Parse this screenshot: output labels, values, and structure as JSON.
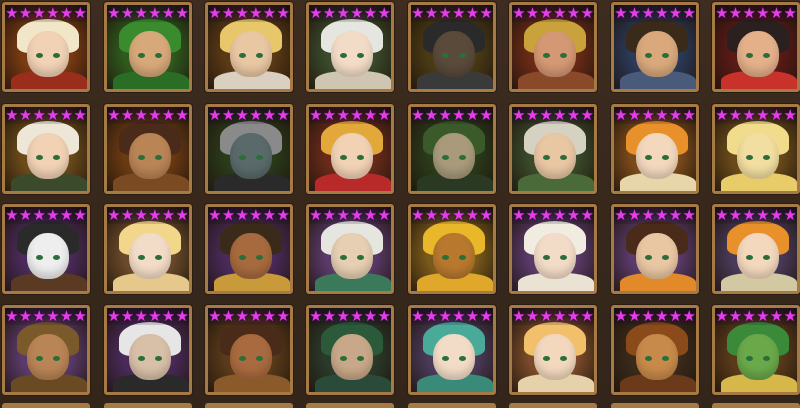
{
  "screen": "monster-collection-grid",
  "star_rating": 6,
  "colors": {
    "background": "#3a2a1d",
    "frame": "#a57a45",
    "star": "#e23fe6"
  },
  "monsters": [
    [
      {
        "name": "fire-elf-girl",
        "bg": "#7a3a12",
        "hair": "#f2e6c8",
        "body": "#9a2d1c",
        "face": "#f1d2b5"
      },
      {
        "name": "wind-ranger",
        "bg": "#2f5a1e",
        "hair": "#3a8a2e",
        "body": "#2a6d24",
        "face": "#d7a879"
      },
      {
        "name": "blonde-warrior",
        "bg": "#5a3a15",
        "hair": "#e8c66a",
        "body": "#d9d0c2",
        "face": "#e9c7a3"
      },
      {
        "name": "silver-haired-girl",
        "bg": "#3a4a2a",
        "hair": "#e6e6e0",
        "body": "#cfc6b2",
        "face": "#f3dcc7"
      },
      {
        "name": "dark-knight",
        "bg": "#4a3a14",
        "hair": "#2a2a2a",
        "body": "#3a3a3a",
        "face": "#5a4a3a"
      },
      {
        "name": "brawler",
        "bg": "#6a2a16",
        "hair": "#c9a23b",
        "body": "#8a4a2a",
        "face": "#d49874"
      },
      {
        "name": "blue-bandit",
        "bg": "#2a3a5a",
        "hair": "#3a2a1a",
        "body": "#4a5a7a",
        "face": "#d9a97c"
      },
      {
        "name": "red-headband-fighter",
        "bg": "#5a1a16",
        "hair": "#2a2020",
        "body": "#c8322a",
        "face": "#e3b08a"
      }
    ],
    [
      {
        "name": "white-haired-elf",
        "bg": "#6a4a1a",
        "hair": "#eee6d6",
        "body": "#3a4a2a",
        "face": "#f1d2b5"
      },
      {
        "name": "tan-shaman",
        "bg": "#6a3a12",
        "hair": "#4a2a18",
        "body": "#7a4a22",
        "face": "#b98456"
      },
      {
        "name": "dark-assassin",
        "bg": "#2a3a1a",
        "hair": "#8a8a8a",
        "body": "#2a2a2a",
        "face": "#5a6a6a"
      },
      {
        "name": "blonde-mage",
        "bg": "#6a2a1a",
        "hair": "#e2a83a",
        "body": "#b82a2a",
        "face": "#f1d2b5"
      },
      {
        "name": "green-hooded",
        "bg": "#2a3a1a",
        "hair": "#3a5a2a",
        "body": "#2a3a22",
        "face": "#a89a7a"
      },
      {
        "name": "forest-guardian",
        "bg": "#3a4a2a",
        "hair": "#d6d2c2",
        "body": "#4a6a3a",
        "face": "#e9c7a3"
      },
      {
        "name": "orange-fairy",
        "bg": "#7a4a1a",
        "hair": "#e8902a",
        "body": "#e6d6aa",
        "face": "#f3d8bd"
      },
      {
        "name": "golden-horse",
        "bg": "#6a4a1a",
        "hair": "#f0dc8a",
        "body": "#e8cc6a",
        "face": "#f2dea0"
      }
    ],
    [
      {
        "name": "panda-warrior",
        "bg": "#4a2a5a",
        "hair": "#2a2a2a",
        "body": "#5a3a22",
        "face": "#eeeeee"
      },
      {
        "name": "golden-elf",
        "bg": "#6a4a2a",
        "hair": "#f2d68a",
        "body": "#e6c88a",
        "face": "#f3dcc7"
      },
      {
        "name": "egyptian-priestess",
        "bg": "#4a2a5a",
        "hair": "#3a2a1a",
        "body": "#c89a3a",
        "face": "#a66a3e"
      },
      {
        "name": "jade-elder",
        "bg": "#5a3a6a",
        "hair": "#e6e6e0",
        "body": "#3a7a5a",
        "face": "#e6cfb2"
      },
      {
        "name": "sun-goddess",
        "bg": "#7a5a1a",
        "hair": "#e8b82a",
        "body": "#e0a82a",
        "face": "#b8782e"
      },
      {
        "name": "white-angel",
        "bg": "#5a3a6a",
        "hair": "#f0ece0",
        "body": "#eae2d2",
        "face": "#f3dcc7"
      },
      {
        "name": "monk-boy",
        "bg": "#5a3a6a",
        "hair": "#4a2a18",
        "body": "#e28a2a",
        "face": "#e9c7a3"
      },
      {
        "name": "orange-sprite",
        "bg": "#4a3a5a",
        "hair": "#e8902a",
        "body": "#d2c8a2",
        "face": "#f3d8bd"
      }
    ],
    [
      {
        "name": "bead-monk",
        "bg": "#5a3a6a",
        "hair": "#7a5a2a",
        "body": "#6a4a22",
        "face": "#b98456"
      },
      {
        "name": "white-hood",
        "bg": "#4a2a5a",
        "hair": "#e6e6e6",
        "body": "#2a2a2a",
        "face": "#d8c0a8"
      },
      {
        "name": "tribal-warrior",
        "bg": "#5a3a1a",
        "hair": "#4a2a18",
        "body": "#8a5a2a",
        "face": "#a86a3e"
      },
      {
        "name": "green-knight",
        "bg": "#2a3a2a",
        "hair": "#2a5a3a",
        "body": "#2a4a3a",
        "face": "#c8a888"
      },
      {
        "name": "teal-fairy",
        "bg": "#4a3a5a",
        "hair": "#4aaa9a",
        "body": "#3a8a7a",
        "face": "#f3dcc7"
      },
      {
        "name": "blonde-angel",
        "bg": "#7a4a2a",
        "hair": "#f2c06a",
        "body": "#e6d2aa",
        "face": "#f3d8bd"
      },
      {
        "name": "lion-beast",
        "bg": "#3a2a1a",
        "hair": "#8a4a1a",
        "body": "#6a3a1a",
        "face": "#c88a4a"
      },
      {
        "name": "green-dragon",
        "bg": "#5a3a1a",
        "hair": "#3a8a3a",
        "body": "#d6b84a",
        "face": "#6aa84a"
      }
    ]
  ]
}
